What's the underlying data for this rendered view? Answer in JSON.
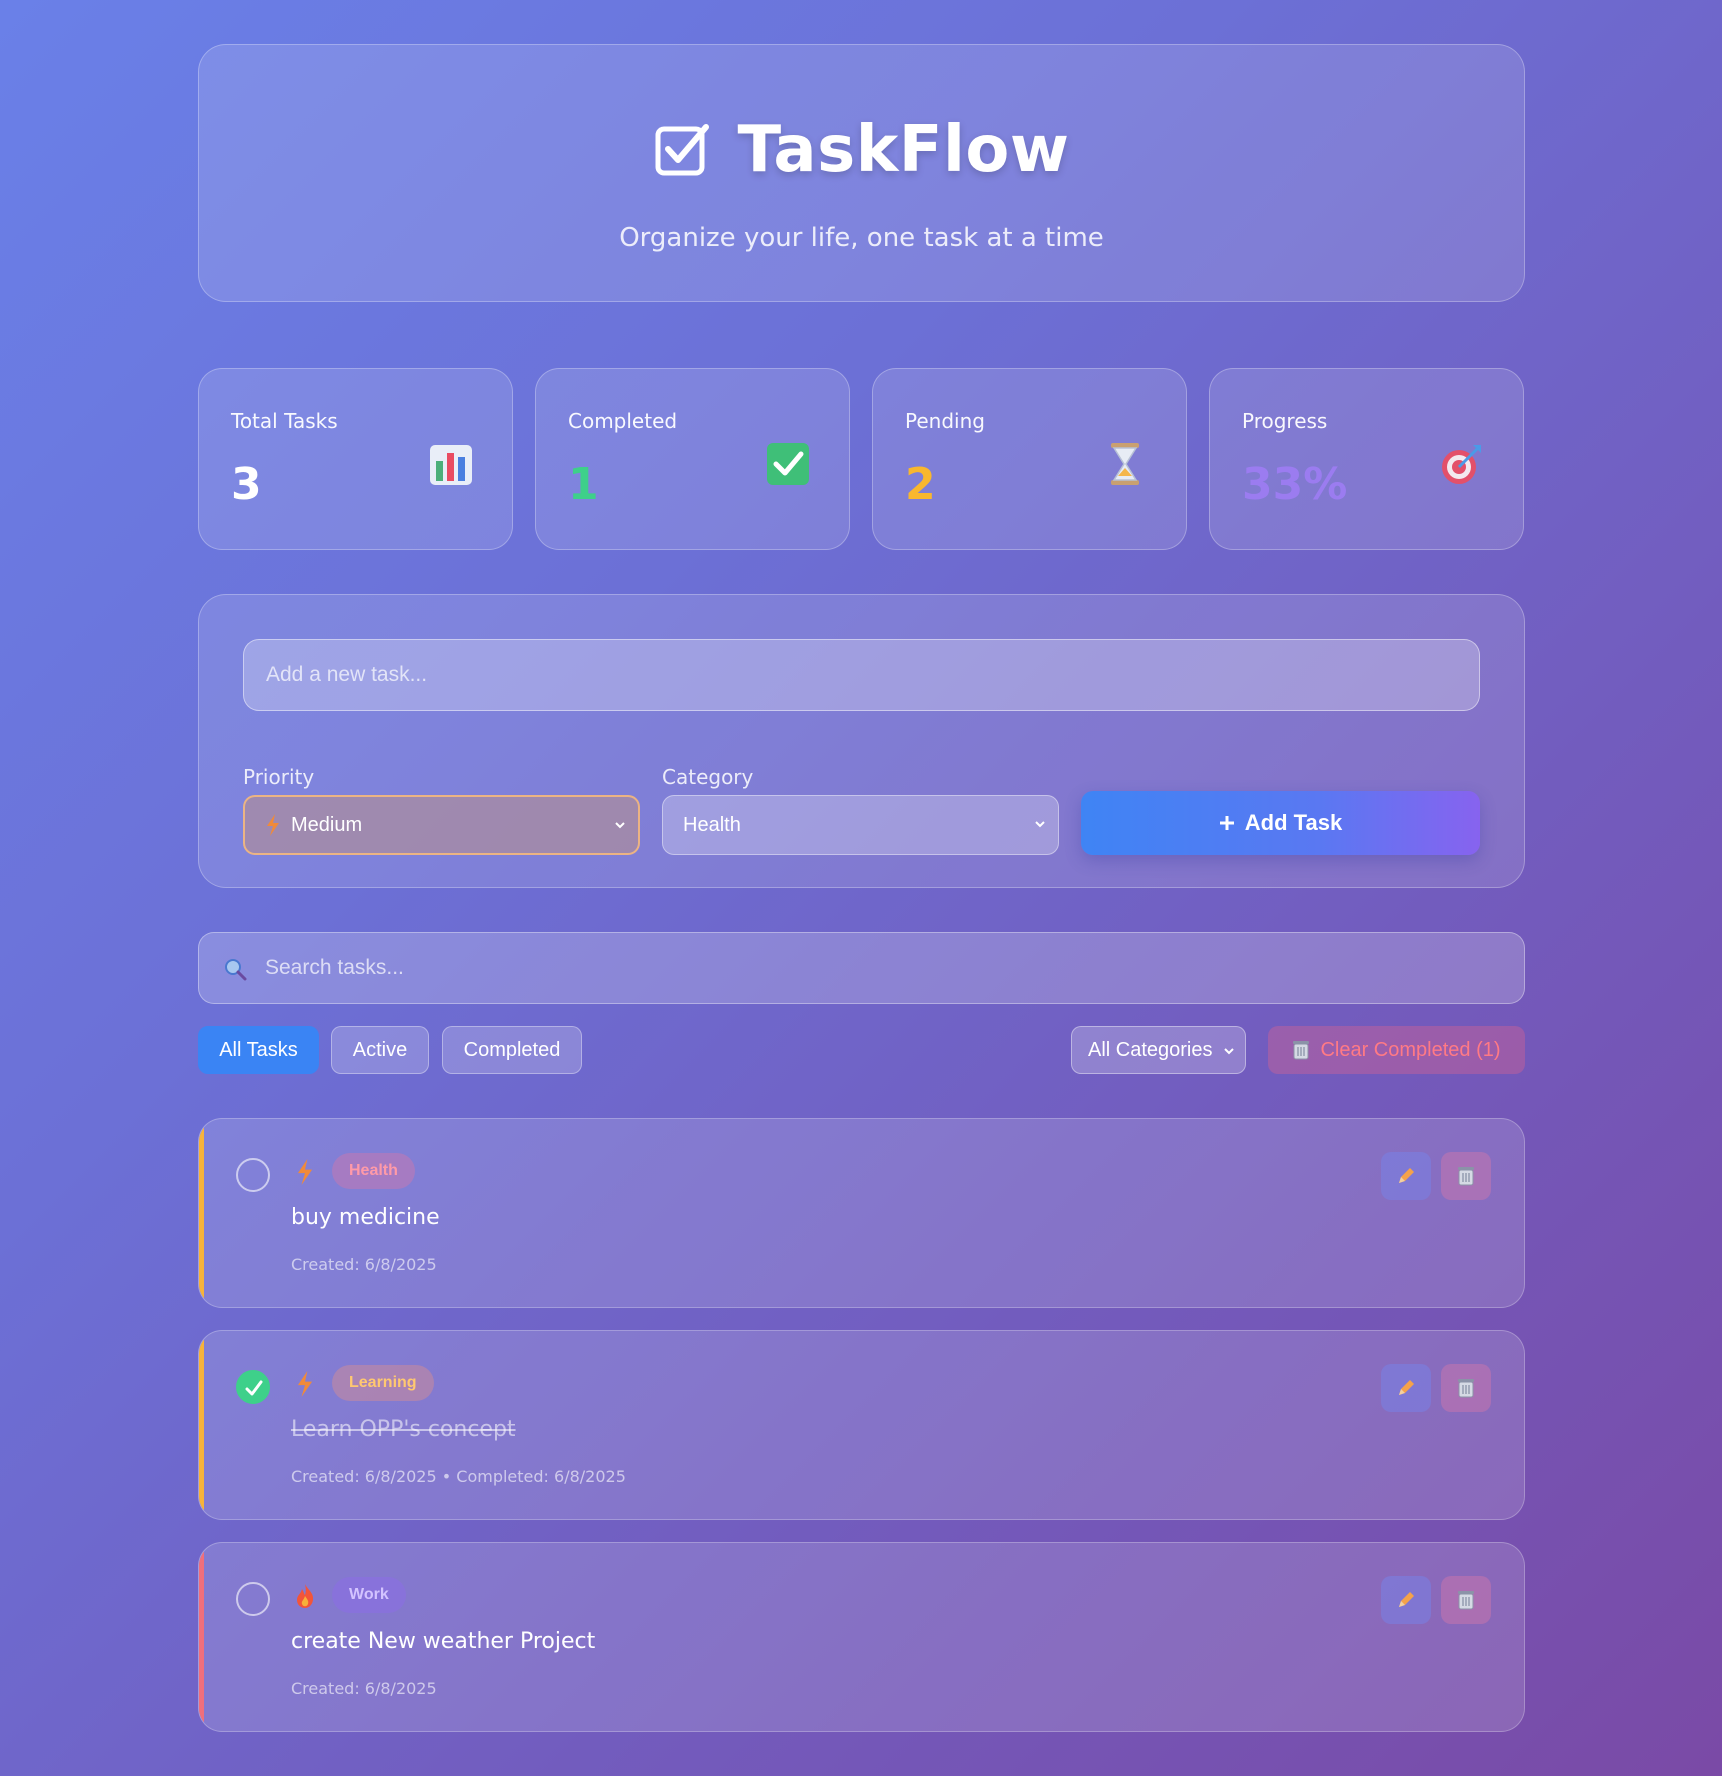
{
  "header": {
    "title": "TaskFlow",
    "subtitle": "Organize your life, one task at a time",
    "icon": "checkbox-icon"
  },
  "stats": [
    {
      "label": "Total Tasks",
      "value": "3",
      "icon": "bar-chart-icon",
      "color": "#ffffff"
    },
    {
      "label": "Completed",
      "value": "1",
      "icon": "check-mark-icon",
      "color": "#3ed08a"
    },
    {
      "label": "Pending",
      "value": "2",
      "icon": "hourglass-icon",
      "color": "#f9b72e"
    },
    {
      "label": "Progress",
      "value": "33%",
      "icon": "target-icon",
      "color": "#9b7cf0"
    }
  ],
  "add_form": {
    "placeholder": "Add a new task...",
    "priority_label": "Priority",
    "priority_value": "Medium",
    "category_label": "Category",
    "category_value": "Health",
    "add_button": "Add Task"
  },
  "search": {
    "placeholder": "Search tasks..."
  },
  "filters": {
    "all": "All Tasks",
    "active": "Active",
    "completed": "Completed",
    "category_select": "All Categories",
    "clear_completed": "Clear Completed (1)"
  },
  "tasks": [
    {
      "category": "Health",
      "text": "buy medicine",
      "meta": "Created: 6/8/2025",
      "done": false,
      "priority": "medium",
      "bar_color": "#f7b33a",
      "badge_bg": "rgba(210,120,170,0.45)",
      "badge_color": "#ff9aa8"
    },
    {
      "category": "Learning",
      "text": "Learn OPP's concept",
      "meta": "Created: 6/8/2025 • Completed: 6/8/2025",
      "done": true,
      "priority": "medium",
      "bar_color": "#f7b33a",
      "badge_bg": "rgba(210,140,150,0.5)",
      "badge_color": "#ffc870"
    },
    {
      "category": "Work",
      "text": "create New weather Project",
      "meta": "Created: 6/8/2025",
      "done": false,
      "priority": "high",
      "bar_color": "#f06f7c",
      "badge_bg": "rgba(140,110,230,0.55)",
      "badge_color": "#d3c3ff"
    }
  ]
}
